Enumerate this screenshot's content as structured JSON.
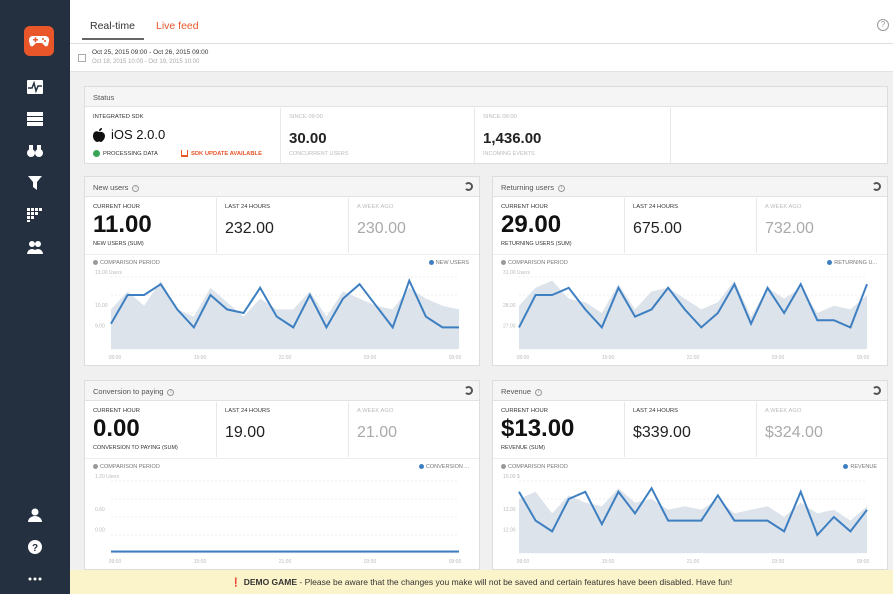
{
  "tabs": {
    "realtime": "Real-time",
    "livefeed": "Live feed"
  },
  "help_top": "?",
  "dates": {
    "current": "Oct 25, 2015 09:00 - Oct 26, 2015 09:00",
    "previous": "Oct 18, 2015 10:00 - Oct 19, 2015 10:00"
  },
  "status": {
    "title": "Status",
    "sdk_label": "INTEGRATED SDK",
    "sdk_value": "iOS 2.0.0",
    "processing": "PROCESSING DATA",
    "update": "SDK UPDATE AVAILABLE",
    "conc_label": "SINCE 09:00",
    "conc_value": "30.00",
    "conc_sub": "CONCURRENT USERS",
    "events_label": "SINCE 09:00",
    "events_value": "1,436.00",
    "events_sub": "INCOMING EVENTS"
  },
  "cards": [
    {
      "title": "New users",
      "hour_label": "CURRENT HOUR",
      "hour_value": "11.00",
      "hour_sub": "NEW USERS (SUM)",
      "day_label": "LAST 24 HOURS",
      "day_value": "232.00",
      "week_label": "A WEEK AGO",
      "week_value": "230.00",
      "comparison": "COMPARISON PERIOD",
      "series_name": "NEW USERS",
      "y_unit": "13.00 Users",
      "y_ticks": [
        "10.00",
        "9.00"
      ],
      "x_ticks": [
        "09:00",
        "15:00",
        "21:00",
        "03:00",
        "09:00"
      ]
    },
    {
      "title": "Returning users",
      "hour_label": "CURRENT HOUR",
      "hour_value": "29.00",
      "hour_sub": "RETURNING USERS (SUM)",
      "day_label": "LAST 24 HOURS",
      "day_value": "675.00",
      "week_label": "A WEEK AGO",
      "week_value": "732.00",
      "comparison": "COMPARISON PERIOD",
      "series_name": "RETURNING U...",
      "y_unit": "31.00 Users",
      "y_ticks": [
        "28.00",
        "27.00"
      ],
      "x_ticks": [
        "09:00",
        "15:00",
        "21:00",
        "03:00",
        "09:00"
      ]
    },
    {
      "title": "Conversion to paying",
      "hour_label": "CURRENT HOUR",
      "hour_value": "0.00",
      "hour_sub": "CONVERSION TO PAYING (SUM)",
      "day_label": "LAST 24 HOURS",
      "day_value": "19.00",
      "week_label": "A WEEK AGO",
      "week_value": "21.00",
      "comparison": "COMPARISON PERIOD",
      "series_name": "CONVERSION ...",
      "y_unit": "1.20 Users",
      "y_ticks": [
        "0.60",
        "0.00"
      ],
      "x_ticks": [
        "09:00",
        "15:00",
        "21:00",
        "03:00",
        "09:00"
      ]
    },
    {
      "title": "Revenue",
      "hour_label": "CURRENT HOUR",
      "hour_value": "$13.00",
      "hour_sub": "REVENUE (SUM)",
      "day_label": "LAST 24 HOURS",
      "day_value": "$339.00",
      "week_label": "A WEEK AGO",
      "week_value": "$324.00",
      "comparison": "COMPARISON PERIOD",
      "series_name": "REVENUE",
      "y_unit": "15.00 $",
      "y_ticks": [
        "13.00",
        "12.00"
      ],
      "x_ticks": [
        "09:00",
        "15:00",
        "21:00",
        "03:00",
        "09:00"
      ]
    }
  ],
  "banner": {
    "bold": "DEMO GAME",
    "text": " - Please be aware that the changes you make will not be saved and certain features have been disabled. Have fun!"
  },
  "colors": {
    "accent": "#e8562a",
    "line": "#3d7fc1",
    "area": "#dde3ea",
    "sidebar": "#243040"
  },
  "chart_lines": [
    [
      0.35,
      0.75,
      0.75,
      0.9,
      0.55,
      0.3,
      0.75,
      0.55,
      0.5,
      0.85,
      0.45,
      0.3,
      0.75,
      0.3,
      0.7,
      0.9,
      0.6,
      0.3,
      0.95,
      0.45,
      0.3,
      0.3
    ],
    [
      0.3,
      0.75,
      0.75,
      0.85,
      0.55,
      0.3,
      0.85,
      0.45,
      0.55,
      0.85,
      0.55,
      0.3,
      0.5,
      0.9,
      0.35,
      0.85,
      0.5,
      0.9,
      0.4,
      0.4,
      0.3,
      0.9
    ],
    [
      0.02,
      0.02,
      0.02,
      0.02,
      0.02,
      0.02,
      0.02,
      0.02,
      0.02,
      0.02,
      0.02,
      0.02,
      0.02,
      0.02,
      0.02,
      0.02,
      0.02,
      0.02,
      0.02,
      0.02,
      0.02,
      0.02
    ],
    [
      0.85,
      0.45,
      0.3,
      0.75,
      0.85,
      0.4,
      0.85,
      0.55,
      0.9,
      0.45,
      0.45,
      0.45,
      0.8,
      0.45,
      0.45,
      0.45,
      0.3,
      0.85,
      0.25,
      0.5,
      0.3,
      0.6
    ]
  ],
  "chart_areas": [
    [
      0.55,
      0.8,
      0.6,
      0.95,
      0.55,
      0.45,
      0.85,
      0.65,
      0.45,
      0.7,
      0.55,
      0.55,
      0.8,
      0.45,
      0.8,
      0.7,
      0.6,
      0.55,
      0.85,
      0.7,
      0.6,
      0.55
    ],
    [
      0.6,
      0.85,
      0.95,
      0.7,
      0.65,
      0.5,
      0.9,
      0.55,
      0.8,
      0.85,
      0.7,
      0.55,
      0.65,
      0.95,
      0.45,
      0.85,
      0.7,
      0.85,
      0.5,
      0.6,
      0.55,
      0.75
    ],
    [
      0.03,
      0.03,
      0.03,
      0.03,
      0.03,
      0.03,
      0.03,
      0.03,
      0.03,
      0.03,
      0.03,
      0.03,
      0.03,
      0.03,
      0.03,
      0.03,
      0.03,
      0.03,
      0.03,
      0.03,
      0.03,
      0.03
    ],
    [
      0.75,
      0.85,
      0.55,
      0.8,
      0.7,
      0.65,
      0.9,
      0.7,
      0.75,
      0.6,
      0.65,
      0.6,
      0.75,
      0.55,
      0.6,
      0.65,
      0.5,
      0.7,
      0.55,
      0.6,
      0.45,
      0.65
    ]
  ]
}
